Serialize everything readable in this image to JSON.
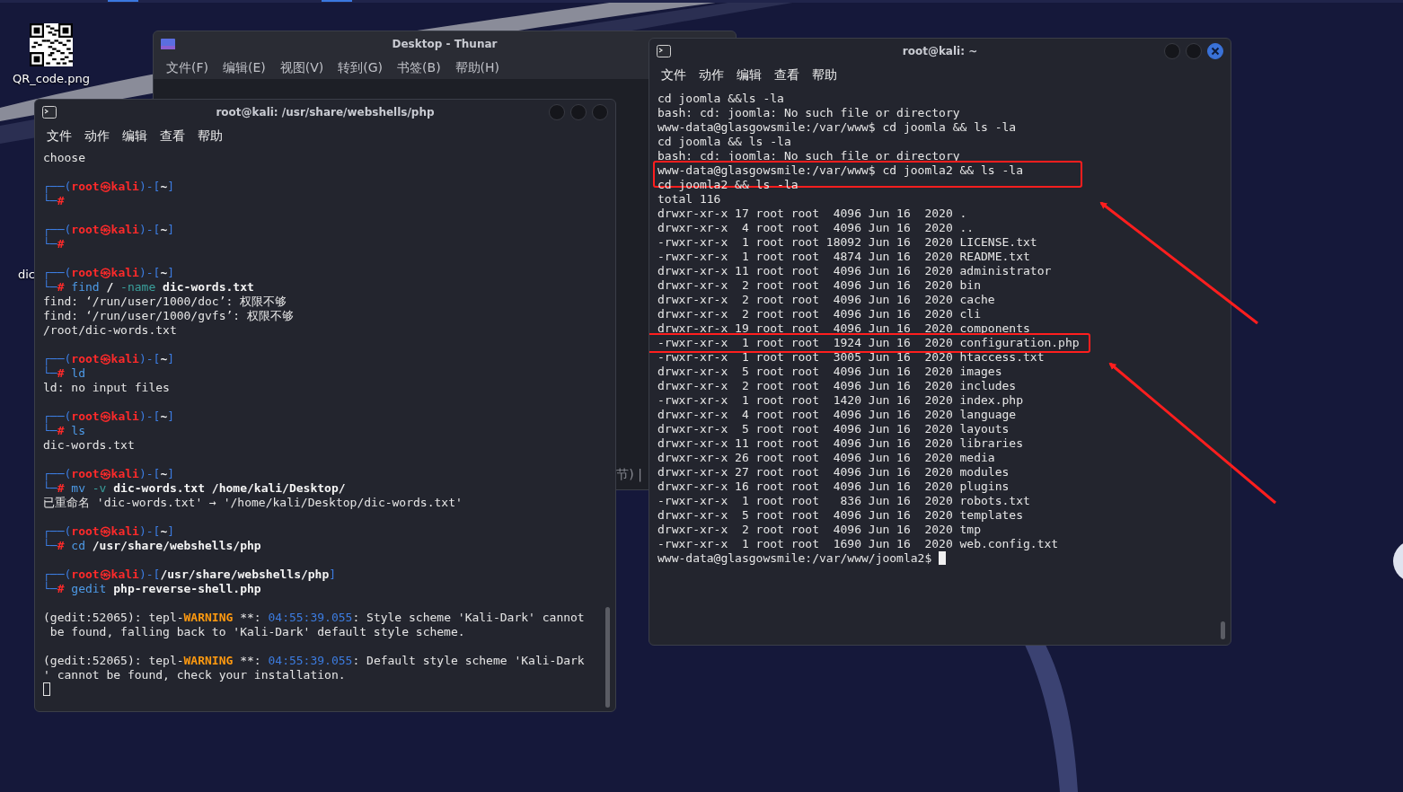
{
  "desktop": {
    "icons": [
      {
        "label": "QR_code.png",
        "kind": "qr"
      },
      {
        "label": "dic",
        "kind": "cut"
      }
    ]
  },
  "file_manager": {
    "title": "Desktop - Thunar",
    "menu": [
      "文件(F)",
      "编辑(E)",
      "视图(V)",
      "转到(G)",
      "书签(B)",
      "帮助(H)"
    ],
    "status": "节) |"
  },
  "terminal_left": {
    "title": "root@kali: /usr/share/webshells/php",
    "menu": [
      "文件",
      "动作",
      "编辑",
      "查看",
      "帮助"
    ],
    "lines": [
      {
        "segs": [
          {
            "t": "choose",
            "kind": "p"
          }
        ]
      },
      {
        "kind": "blank"
      },
      {
        "segs": [
          {
            "t": "┌──(",
            "kind": "b"
          },
          {
            "t": "root㉿kali",
            "kind": "r"
          },
          {
            "t": ")-[",
            "kind": "b"
          },
          {
            "t": "~",
            "kind": "w"
          },
          {
            "t": "]",
            "kind": "b"
          }
        ]
      },
      {
        "segs": [
          {
            "t": "└─",
            "kind": "b"
          },
          {
            "t": "#",
            "kind": "r"
          }
        ]
      },
      {
        "kind": "blank"
      },
      {
        "segs": [
          {
            "t": "┌──(",
            "kind": "b"
          },
          {
            "t": "root㉿kali",
            "kind": "r"
          },
          {
            "t": ")-[",
            "kind": "b"
          },
          {
            "t": "~",
            "kind": "w"
          },
          {
            "t": "]",
            "kind": "b"
          }
        ]
      },
      {
        "segs": [
          {
            "t": "└─",
            "kind": "b"
          },
          {
            "t": "#",
            "kind": "r"
          }
        ]
      },
      {
        "kind": "blank"
      },
      {
        "segs": [
          {
            "t": "┌──(",
            "kind": "b"
          },
          {
            "t": "root㉿kali",
            "kind": "r"
          },
          {
            "t": ")-[",
            "kind": "b"
          },
          {
            "t": "~",
            "kind": "w"
          },
          {
            "t": "]",
            "kind": "b"
          }
        ]
      },
      {
        "segs": [
          {
            "t": "└─",
            "kind": "b"
          },
          {
            "t": "#",
            "kind": "r"
          },
          {
            "t": " find",
            "kind": "c"
          },
          {
            "t": " /",
            "kind": "w"
          },
          {
            "t": " -name",
            "kind": "o"
          },
          {
            "t": " dic-words.txt",
            "kind": "w"
          }
        ]
      },
      {
        "segs": [
          {
            "t": "find: ‘/run/user/1000/doc’: 权限不够",
            "kind": "p"
          }
        ]
      },
      {
        "segs": [
          {
            "t": "find: ‘/run/user/1000/gvfs’: 权限不够",
            "kind": "p"
          }
        ]
      },
      {
        "segs": [
          {
            "t": "/root/dic-words.txt",
            "kind": "p"
          }
        ]
      },
      {
        "kind": "blank"
      },
      {
        "segs": [
          {
            "t": "┌──(",
            "kind": "b"
          },
          {
            "t": "root㉿kali",
            "kind": "r"
          },
          {
            "t": ")-[",
            "kind": "b"
          },
          {
            "t": "~",
            "kind": "w"
          },
          {
            "t": "]",
            "kind": "b"
          }
        ]
      },
      {
        "segs": [
          {
            "t": "└─",
            "kind": "b"
          },
          {
            "t": "#",
            "kind": "r"
          },
          {
            "t": " ld",
            "kind": "c"
          }
        ]
      },
      {
        "segs": [
          {
            "t": "ld: no input files",
            "kind": "p"
          }
        ]
      },
      {
        "kind": "blank"
      },
      {
        "segs": [
          {
            "t": "┌──(",
            "kind": "b"
          },
          {
            "t": "root㉿kali",
            "kind": "r"
          },
          {
            "t": ")-[",
            "kind": "b"
          },
          {
            "t": "~",
            "kind": "w"
          },
          {
            "t": "]",
            "kind": "b"
          }
        ]
      },
      {
        "segs": [
          {
            "t": "└─",
            "kind": "b"
          },
          {
            "t": "#",
            "kind": "r"
          },
          {
            "t": " ls",
            "kind": "c"
          }
        ]
      },
      {
        "segs": [
          {
            "t": "dic-words.txt",
            "kind": "p"
          }
        ]
      },
      {
        "kind": "blank"
      },
      {
        "segs": [
          {
            "t": "┌──(",
            "kind": "b"
          },
          {
            "t": "root㉿kali",
            "kind": "r"
          },
          {
            "t": ")-[",
            "kind": "b"
          },
          {
            "t": "~",
            "kind": "w"
          },
          {
            "t": "]",
            "kind": "b"
          }
        ]
      },
      {
        "segs": [
          {
            "t": "└─",
            "kind": "b"
          },
          {
            "t": "#",
            "kind": "r"
          },
          {
            "t": " mv",
            "kind": "c"
          },
          {
            "t": " -v",
            "kind": "o"
          },
          {
            "t": " dic-words.txt /home/kali/Desktop/",
            "kind": "w"
          }
        ]
      },
      {
        "segs": [
          {
            "t": "已重命名 'dic-words.txt' → '/home/kali/Desktop/dic-words.txt'",
            "kind": "p"
          }
        ]
      },
      {
        "kind": "blank"
      },
      {
        "segs": [
          {
            "t": "┌──(",
            "kind": "b"
          },
          {
            "t": "root㉿kali",
            "kind": "r"
          },
          {
            "t": ")-[",
            "kind": "b"
          },
          {
            "t": "~",
            "kind": "w"
          },
          {
            "t": "]",
            "kind": "b"
          }
        ]
      },
      {
        "segs": [
          {
            "t": "└─",
            "kind": "b"
          },
          {
            "t": "#",
            "kind": "r"
          },
          {
            "t": " cd",
            "kind": "c"
          },
          {
            "t": " /usr/share/webshells/php",
            "kind": "w"
          }
        ]
      },
      {
        "kind": "blank"
      },
      {
        "segs": [
          {
            "t": "┌──(",
            "kind": "b"
          },
          {
            "t": "root㉿kali",
            "kind": "r"
          },
          {
            "t": ")-[",
            "kind": "b"
          },
          {
            "t": "/usr/share/webshells/php",
            "kind": "w"
          },
          {
            "t": "]",
            "kind": "b"
          }
        ]
      },
      {
        "segs": [
          {
            "t": "└─",
            "kind": "b"
          },
          {
            "t": "#",
            "kind": "r"
          },
          {
            "t": " gedit",
            "kind": "c"
          },
          {
            "t": " php-reverse-shell.php",
            "kind": "w"
          }
        ]
      },
      {
        "kind": "blank"
      },
      {
        "segs": [
          {
            "t": "(gedit:52065): tepl-",
            "kind": "p"
          },
          {
            "t": "WARNING",
            "kind": "warn"
          },
          {
            "t": " **: ",
            "kind": "p"
          },
          {
            "t": "04:55:39.055",
            "kind": "time"
          },
          {
            "t": ": Style scheme 'Kali-Dark' cannot",
            "kind": "p"
          }
        ]
      },
      {
        "segs": [
          {
            "t": " be found, falling back to 'Kali-Dark' default style scheme.",
            "kind": "p"
          }
        ]
      },
      {
        "kind": "blank"
      },
      {
        "segs": [
          {
            "t": "(gedit:52065): tepl-",
            "kind": "p"
          },
          {
            "t": "WARNING",
            "kind": "warn"
          },
          {
            "t": " **: ",
            "kind": "p"
          },
          {
            "t": "04:55:39.055",
            "kind": "time"
          },
          {
            "t": ": Default style scheme 'Kali-Dark",
            "kind": "p"
          }
        ]
      },
      {
        "segs": [
          {
            "t": "' cannot be found, check your installation.",
            "kind": "p"
          }
        ]
      },
      {
        "kind": "cursor"
      }
    ]
  },
  "terminal_right": {
    "title": "root@kali: ~",
    "menu": [
      "文件",
      "动作",
      "编辑",
      "查看",
      "帮助"
    ],
    "lines": [
      {
        "text": "cd joomla &&ls -la",
        "boxed": false
      },
      {
        "text": "bash: cd: joomla: No such file or directory",
        "boxed": false
      },
      {
        "text": "www-data@glasgowsmile:/var/www$ cd joomla && ls -la",
        "boxed": false
      },
      {
        "text": "cd joomla && ls -la",
        "boxed": false
      },
      {
        "text": "bash: cd: joomla: No such file or directory",
        "boxed": false
      },
      {
        "text": "www-data@glasgowsmile:/var/www$ cd joomla2 && ls -la",
        "boxed": true
      },
      {
        "text": "cd joomla2 && ls -la",
        "boxed": false
      },
      {
        "text": "total 116",
        "boxed": false
      },
      {
        "text": "drwxr-xr-x 17 root root  4096 Jun 16  2020 .",
        "boxed": false
      },
      {
        "text": "drwxr-xr-x  4 root root  4096 Jun 16  2020 ..",
        "boxed": false
      },
      {
        "text": "-rwxr-xr-x  1 root root 18092 Jun 16  2020 LICENSE.txt",
        "boxed": false
      },
      {
        "text": "-rwxr-xr-x  1 root root  4874 Jun 16  2020 README.txt",
        "boxed": false
      },
      {
        "text": "drwxr-xr-x 11 root root  4096 Jun 16  2020 administrator",
        "boxed": false
      },
      {
        "text": "drwxr-xr-x  2 root root  4096 Jun 16  2020 bin",
        "boxed": false
      },
      {
        "text": "drwxr-xr-x  2 root root  4096 Jun 16  2020 cache",
        "boxed": false
      },
      {
        "text": "drwxr-xr-x  2 root root  4096 Jun 16  2020 cli",
        "boxed": false
      },
      {
        "text": "drwxr-xr-x 19 root root  4096 Jun 16  2020 components",
        "boxed": false
      },
      {
        "text": "-rwxr-xr-x  1 root root  1924 Jun 16  2020 configuration.php",
        "boxed": true
      },
      {
        "text": "-rwxr-xr-x  1 root root  3005 Jun 16  2020 htaccess.txt",
        "boxed": false
      },
      {
        "text": "drwxr-xr-x  5 root root  4096 Jun 16  2020 images",
        "boxed": false
      },
      {
        "text": "drwxr-xr-x  2 root root  4096 Jun 16  2020 includes",
        "boxed": false
      },
      {
        "text": "-rwxr-xr-x  1 root root  1420 Jun 16  2020 index.php",
        "boxed": false
      },
      {
        "text": "drwxr-xr-x  4 root root  4096 Jun 16  2020 language",
        "boxed": false
      },
      {
        "text": "drwxr-xr-x  5 root root  4096 Jun 16  2020 layouts",
        "boxed": false
      },
      {
        "text": "drwxr-xr-x 11 root root  4096 Jun 16  2020 libraries",
        "boxed": false
      },
      {
        "text": "drwxr-xr-x 26 root root  4096 Jun 16  2020 media",
        "boxed": false
      },
      {
        "text": "drwxr-xr-x 27 root root  4096 Jun 16  2020 modules",
        "boxed": false
      },
      {
        "text": "drwxr-xr-x 16 root root  4096 Jun 16  2020 plugins",
        "boxed": false
      },
      {
        "text": "-rwxr-xr-x  1 root root   836 Jun 16  2020 robots.txt",
        "boxed": false
      },
      {
        "text": "drwxr-xr-x  5 root root  4096 Jun 16  2020 templates",
        "boxed": false
      },
      {
        "text": "drwxr-xr-x  2 root root  4096 Jun 16  2020 tmp",
        "boxed": false
      },
      {
        "text": "-rwxr-xr-x  1 root root  1690 Jun 16  2020 web.config.txt",
        "boxed": false
      },
      {
        "text": "www-data@glasgowsmile:/var/www/joomla2$ ",
        "boxed": false,
        "cursor": true
      }
    ]
  }
}
